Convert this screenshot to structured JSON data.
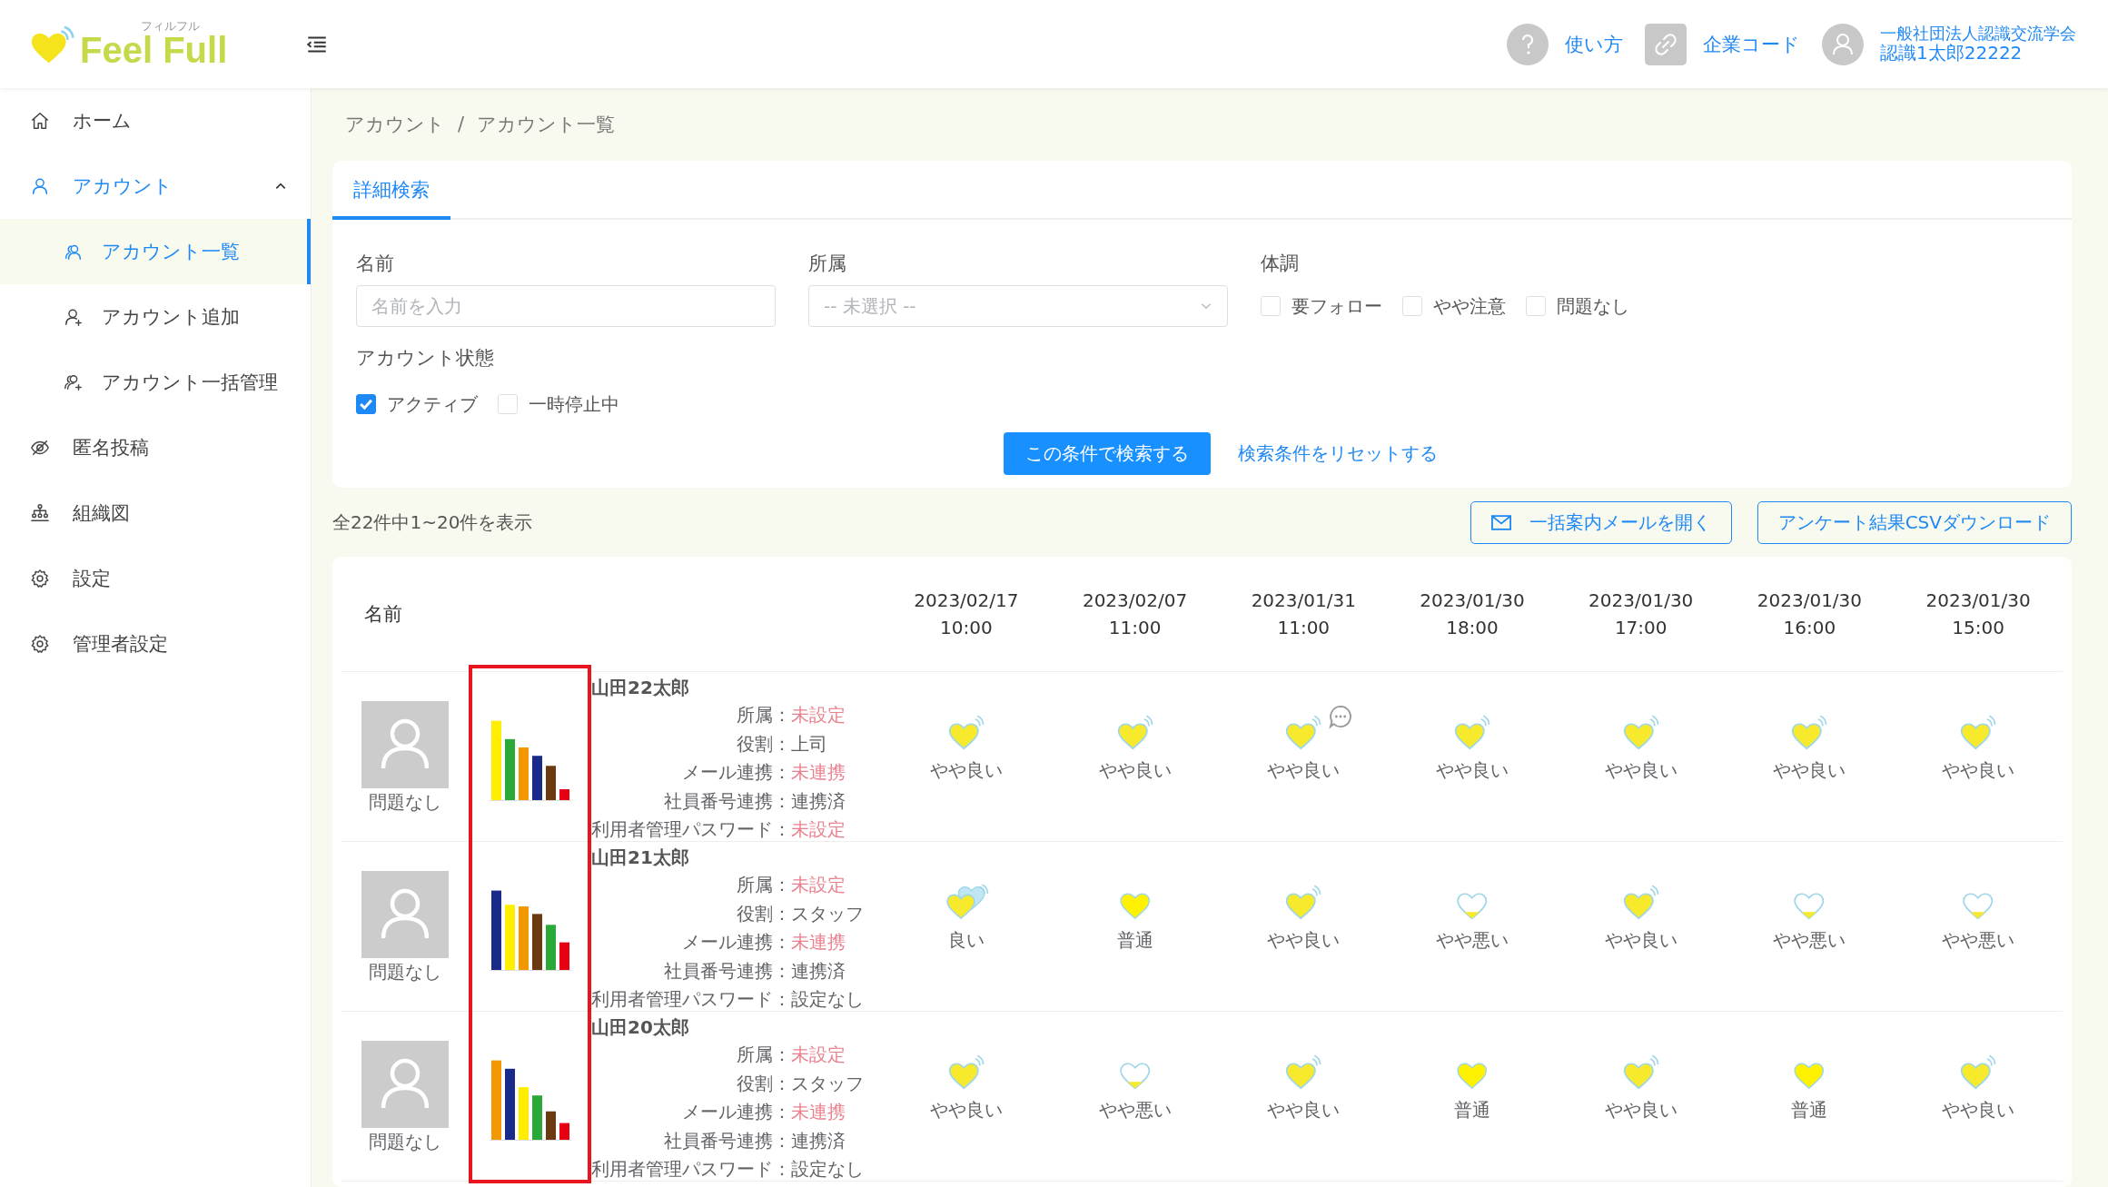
{
  "header": {
    "logo_text": "Feel Full",
    "logo_kana": "フィルフル",
    "help_label": "使い方",
    "company_code_label": "企業コード",
    "user_org": "一般社団法人認識交流学会",
    "user_name": "認識1太郎22222"
  },
  "sidebar": {
    "items": [
      {
        "label": "ホーム",
        "selected": false
      },
      {
        "label": "アカウント",
        "expanded": true,
        "children": [
          {
            "label": "アカウント一覧",
            "selected": true
          },
          {
            "label": "アカウント追加",
            "selected": false
          },
          {
            "label": "アカウント一括管理",
            "selected": false
          }
        ]
      },
      {
        "label": "匿名投稿",
        "selected": false
      },
      {
        "label": "組織図",
        "selected": false
      },
      {
        "label": "設定",
        "selected": false
      },
      {
        "label": "管理者設定",
        "selected": false
      }
    ]
  },
  "breadcrumb": {
    "items": [
      "アカウント",
      "アカウント一覧"
    ],
    "separator": "/"
  },
  "search": {
    "tabs": [
      {
        "label": "詳細検索",
        "selected": true
      }
    ],
    "name_field": {
      "label": "名前",
      "placeholder": "名前を入力"
    },
    "affiliation_field": {
      "label": "所属",
      "placeholder": "-- 未選択 --"
    },
    "condition": {
      "label": "体調",
      "options": [
        {
          "label": "要フォロー",
          "checked": false
        },
        {
          "label": "やや注意",
          "checked": false
        },
        {
          "label": "問題なし",
          "checked": false
        }
      ]
    },
    "account_status": {
      "label": "アカウント状態",
      "options": [
        {
          "label": "アクティブ",
          "checked": true
        },
        {
          "label": "一時停止中",
          "checked": false
        }
      ]
    },
    "search_button": "この条件で検索する",
    "reset_link": "検索条件をリセットする"
  },
  "results": {
    "summary": "全22件中1~20件を表示",
    "actions": [
      {
        "label": "一括案内メールを開く",
        "kind": "mail"
      },
      {
        "label": "アンケート結果CSVダウンロード",
        "kind": "plain"
      }
    ]
  },
  "table": {
    "name_header": "名前",
    "separator": "：",
    "columns": [
      {
        "date": "2023/02/17",
        "time": "10:00"
      },
      {
        "date": "2023/02/07",
        "time": "11:00"
      },
      {
        "date": "2023/01/31",
        "time": "11:00"
      },
      {
        "date": "2023/01/30",
        "time": "18:00"
      },
      {
        "date": "2023/01/30",
        "time": "17:00"
      },
      {
        "date": "2023/01/30",
        "time": "16:00"
      },
      {
        "date": "2023/01/30",
        "time": "15:00"
      }
    ],
    "rows": [
      {
        "name": "山田22太郎",
        "status": "問題なし",
        "fields": [
          {
            "label": "所属",
            "value": "未設定",
            "alert": true
          },
          {
            "label": "役割",
            "value": "上司",
            "alert": false
          },
          {
            "label": "メール連携",
            "value": "未連携",
            "alert": true
          },
          {
            "label": "社員番号連携",
            "value": "連携済",
            "alert": false
          },
          {
            "label": "利用者管理パスワード",
            "value": "未設定",
            "alert": true
          }
        ],
        "cells": [
          {
            "kind": "fairly_good",
            "label": "やや良い",
            "comment": false
          },
          {
            "kind": "fairly_good",
            "label": "やや良い",
            "comment": false
          },
          {
            "kind": "fairly_good",
            "label": "やや良い",
            "comment": true
          },
          {
            "kind": "fairly_good",
            "label": "やや良い",
            "comment": false
          },
          {
            "kind": "fairly_good",
            "label": "やや良い",
            "comment": false
          },
          {
            "kind": "fairly_good",
            "label": "やや良い",
            "comment": false
          },
          {
            "kind": "fairly_good",
            "label": "やや良い",
            "comment": false
          }
        ]
      },
      {
        "name": "山田21太郎",
        "status": "問題なし",
        "fields": [
          {
            "label": "所属",
            "value": "未設定",
            "alert": true
          },
          {
            "label": "役割",
            "value": "スタッフ",
            "alert": false
          },
          {
            "label": "メール連携",
            "value": "未連携",
            "alert": true
          },
          {
            "label": "社員番号連携",
            "value": "連携済",
            "alert": false
          },
          {
            "label": "利用者管理パスワード",
            "value": "設定なし",
            "alert": false
          }
        ],
        "cells": [
          {
            "kind": "good",
            "label": "良い",
            "comment": false
          },
          {
            "kind": "normal",
            "label": "普通",
            "comment": false
          },
          {
            "kind": "fairly_good",
            "label": "やや良い",
            "comment": false
          },
          {
            "kind": "fairly_bad",
            "label": "やや悪い",
            "comment": false
          },
          {
            "kind": "fairly_good",
            "label": "やや良い",
            "comment": false
          },
          {
            "kind": "fairly_bad",
            "label": "やや悪い",
            "comment": false
          },
          {
            "kind": "fairly_bad",
            "label": "やや悪い",
            "comment": false
          }
        ]
      },
      {
        "name": "山田20太郎",
        "status": "問題なし",
        "fields": [
          {
            "label": "所属",
            "value": "未設定",
            "alert": true
          },
          {
            "label": "役割",
            "value": "スタッフ",
            "alert": false
          },
          {
            "label": "メール連携",
            "value": "未連携",
            "alert": true
          },
          {
            "label": "社員番号連携",
            "value": "連携済",
            "alert": false
          },
          {
            "label": "利用者管理パスワード",
            "value": "設定なし",
            "alert": false
          }
        ],
        "cells": [
          {
            "kind": "fairly_good",
            "label": "やや良い",
            "comment": false
          },
          {
            "kind": "fairly_bad",
            "label": "やや悪い",
            "comment": false
          },
          {
            "kind": "fairly_good",
            "label": "やや良い",
            "comment": false
          },
          {
            "kind": "normal",
            "label": "普通",
            "comment": false
          },
          {
            "kind": "fairly_good",
            "label": "やや良い",
            "comment": false
          },
          {
            "kind": "normal",
            "label": "普通",
            "comment": false
          },
          {
            "kind": "fairly_good",
            "label": "やや良い",
            "comment": false
          }
        ]
      }
    ]
  }
}
